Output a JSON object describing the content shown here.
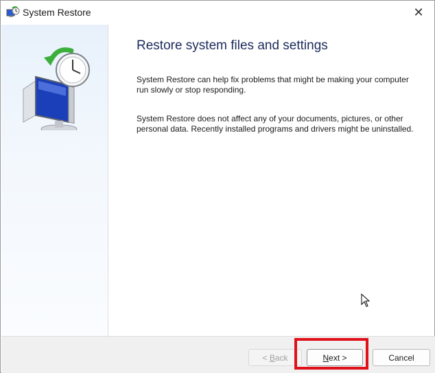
{
  "window": {
    "title": "System Restore",
    "close_glyph": "✕",
    "icon": "system-restore-icon"
  },
  "sidebar": {
    "illustration": "monitor-clock-restore-icon"
  },
  "main": {
    "heading": "Restore system files and settings",
    "paragraph1": "System Restore can help fix problems that might be making your computer run slowly or stop responding.",
    "paragraph2": "System Restore does not affect any of your documents, pictures, or other personal data. Recently installed programs and drivers might be uninstalled."
  },
  "footer": {
    "back_prefix": "< ",
    "back_access_key": "B",
    "back_rest": "ack",
    "next_access_key": "N",
    "next_rest": "ext >",
    "cancel_label": "Cancel",
    "back_enabled": false
  },
  "annotation": {
    "highlight_color": "#e0101b",
    "highlight_target": "next-button"
  },
  "colors": {
    "heading": "#1b2a5a",
    "sidebar_top": "#e8f1fb",
    "footer_bg": "#f0f0f0"
  }
}
